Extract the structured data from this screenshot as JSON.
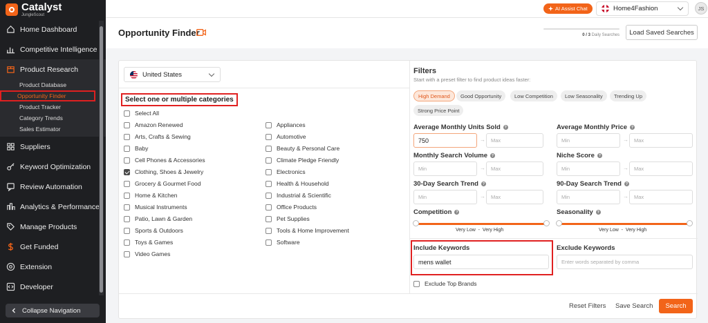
{
  "brand": {
    "name": "Catalyst",
    "sub": "JungleScout"
  },
  "sidebar": {
    "items": [
      {
        "label": "Home Dashboard"
      },
      {
        "label": "Competitive Intelligence"
      },
      {
        "label": "Product Research"
      },
      {
        "label": "Suppliers"
      },
      {
        "label": "Keyword Optimization"
      },
      {
        "label": "Review Automation"
      },
      {
        "label": "Analytics & Performance"
      },
      {
        "label": "Manage Products"
      },
      {
        "label": "Get Funded"
      },
      {
        "label": "Extension"
      },
      {
        "label": "Developer"
      }
    ],
    "sub_items": [
      {
        "label": "Product Database"
      },
      {
        "label": "Opportunity Finder"
      },
      {
        "label": "Product Tracker"
      },
      {
        "label": "Category Trends"
      },
      {
        "label": "Sales Estimator"
      }
    ],
    "collapse_label": "Collapse Navigation"
  },
  "topbar": {
    "ai_button": "AI Assist Chat",
    "account": "Home4Fashion",
    "avatar_initials": "JS"
  },
  "header": {
    "title": "Opportunity Finder",
    "daily_searches_count": "0 / 3",
    "daily_searches_label": "Daily Searches",
    "daily_searches_progress": 0,
    "load_button": "Load Saved Searches"
  },
  "marketplace": {
    "selected": "United States"
  },
  "categories": {
    "heading": "Select one or multiple categories",
    "select_all": "Select All",
    "left": [
      {
        "label": "Amazon Renewed",
        "checked": false
      },
      {
        "label": "Arts, Crafts & Sewing",
        "checked": false
      },
      {
        "label": "Baby",
        "checked": false
      },
      {
        "label": "Cell Phones & Accessories",
        "checked": false
      },
      {
        "label": "Clothing, Shoes & Jewelry",
        "checked": true
      },
      {
        "label": "Grocery & Gourmet Food",
        "checked": false
      },
      {
        "label": "Home & Kitchen",
        "checked": false
      },
      {
        "label": "Musical Instruments",
        "checked": false
      },
      {
        "label": "Patio, Lawn & Garden",
        "checked": false
      },
      {
        "label": "Sports & Outdoors",
        "checked": false
      },
      {
        "label": "Toys & Games",
        "checked": false
      },
      {
        "label": "Video Games",
        "checked": false
      }
    ],
    "right": [
      {
        "label": "Appliances",
        "checked": false
      },
      {
        "label": "Automotive",
        "checked": false
      },
      {
        "label": "Beauty & Personal Care",
        "checked": false
      },
      {
        "label": "Climate Pledge Friendly",
        "checked": false
      },
      {
        "label": "Electronics",
        "checked": false
      },
      {
        "label": "Health & Household",
        "checked": false
      },
      {
        "label": "Industrial & Scientific",
        "checked": false
      },
      {
        "label": "Office Products",
        "checked": false
      },
      {
        "label": "Pet Supplies",
        "checked": false
      },
      {
        "label": "Tools & Home Improvement",
        "checked": false
      },
      {
        "label": "Software",
        "checked": false
      }
    ]
  },
  "filters": {
    "title": "Filters",
    "subtitle": "Start with a preset filter to find product ideas faster:",
    "presets": [
      "High Demand",
      "Good Opportunity",
      "Low Competition",
      "Low Seasonality",
      "Trending Up",
      "Strong Price Point"
    ],
    "active_preset": "High Demand",
    "min_placeholder": "Min",
    "max_placeholder": "Max",
    "units_sold": {
      "label": "Average Monthly Units Sold",
      "min": "750"
    },
    "monthly_price": {
      "label": "Average Monthly Price"
    },
    "search_volume": {
      "label": "Monthly Search Volume"
    },
    "niche_score": {
      "label": "Niche Score"
    },
    "trend_30": {
      "label": "30-Day Search Trend"
    },
    "trend_90": {
      "label": "90-Day Search Trend"
    },
    "competition": {
      "label": "Competition",
      "low": "Very Low",
      "high": "Very High"
    },
    "seasonality": {
      "label": "Seasonality",
      "low": "Very Low",
      "high": "Very High"
    },
    "include_keywords": {
      "label": "Include Keywords",
      "value": "mens wallet"
    },
    "exclude_keywords": {
      "label": "Exclude Keywords",
      "placeholder": "Enter words separated by comma"
    },
    "exclude_top_brands": "Exclude Top Brands"
  },
  "footer": {
    "reset": "Reset Filters",
    "save": "Save Search",
    "search": "Search"
  },
  "colors": {
    "accent": "#f26419",
    "sidebar_bg": "#1e1f22",
    "highlight": "#e02020"
  }
}
